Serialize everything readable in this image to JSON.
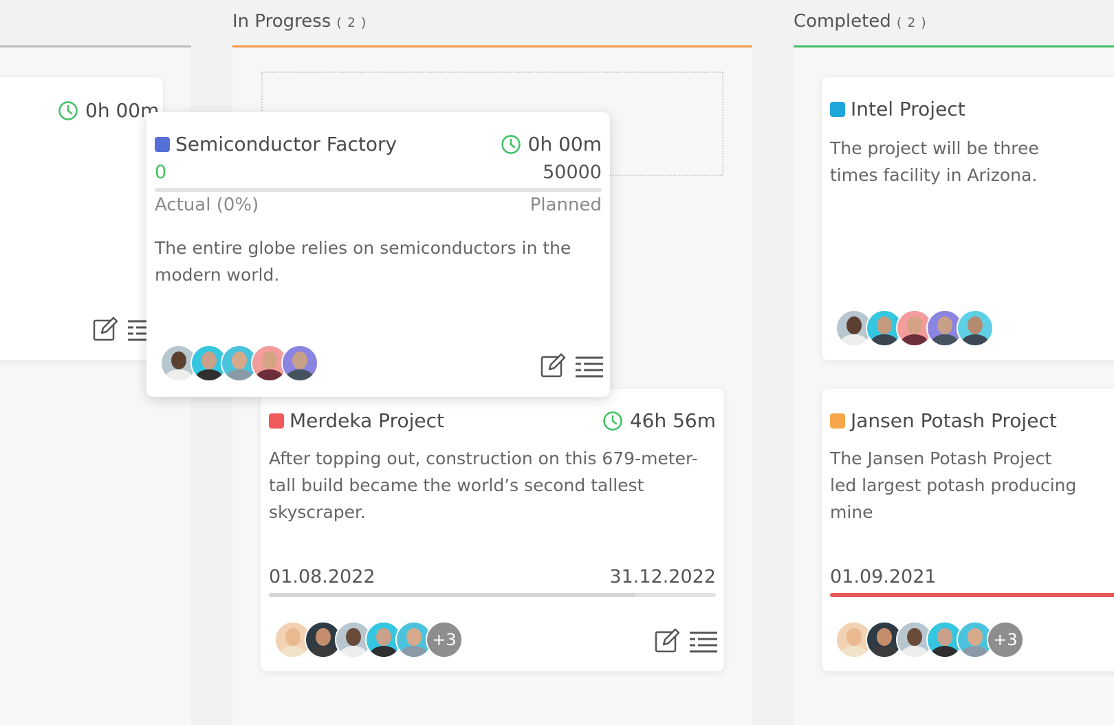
{
  "columns": [
    {
      "key": "left",
      "title": "",
      "count": "",
      "color": "#bdbdbd"
    },
    {
      "key": "in_progress",
      "title": "In Progress",
      "count": "( 2 )",
      "color": "#f29b4a"
    },
    {
      "key": "completed",
      "title": "Completed",
      "count": "( 2 )",
      "color": "#3fc064"
    }
  ],
  "left_card": {
    "time": "0h 00m"
  },
  "dragging_card": {
    "title": "Semiconductor Factory",
    "color": "#5470d6",
    "time": "0h 00m",
    "actual_value": "0",
    "planned_value": "50000",
    "actual_label": "Actual (0%)",
    "planned_label": "Planned",
    "progress": 0,
    "description": "The entire globe relies on semiconductors in the modern world."
  },
  "merdeka_card": {
    "title": "Merdeka Project",
    "color": "#f05a5a",
    "time": "46h 56m",
    "description": "After topping out, construction on this 679-meter-tall build became the world’s second tallest skyscraper.",
    "start_date": "01.08.2022",
    "end_date": "31.12.2022",
    "progress": 0.82,
    "more": "+3"
  },
  "intel_card": {
    "title": "Intel Project",
    "color": "#1ea5dc",
    "description": "The project will be three times facility in Arizona."
  },
  "jansen_card": {
    "title": "Jansen Potash Project",
    "color": "#f7a64a",
    "description": "The Jansen Potash Project led largest potash producing mine",
    "start_date": "01.09.2021",
    "progress": 1.0,
    "more": "+3"
  },
  "icons": {
    "clock": "clock-icon",
    "edit": "edit-icon",
    "list": "list-icon"
  }
}
